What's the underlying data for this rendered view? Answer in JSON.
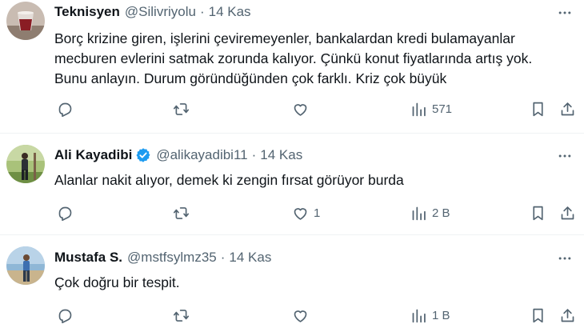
{
  "tweets": [
    {
      "name": "Teknisyen",
      "handle": "@Silivriyolu",
      "dot": "·",
      "time": "14 Kas",
      "text": "Borç krizine giren, işlerini çeviremeyenler, bankalardan kredi bulamayanlar mecburen evlerini satmak zorunda kalıyor.  Çünkü konut fiyatlarında artış yok.  Bunu anlayın.  Durum göründüğünden çok farklı.  Kriz çok büyük",
      "verified": false,
      "replies": "",
      "retweets": "",
      "likes": "",
      "views": "571"
    },
    {
      "name": "Ali Kayadibi",
      "handle": "@alikayadibi11",
      "dot": "·",
      "time": "14 Kas",
      "text": "Alanlar nakit alıyor, demek ki zengin fırsat görüyor burda",
      "verified": true,
      "replies": "",
      "retweets": "",
      "likes": "1",
      "views": "2 B"
    },
    {
      "name": "Mustafa S.",
      "handle": "@mstfsylmz35",
      "dot": "·",
      "time": "14 Kas",
      "text": "Çok doğru bir tespit.",
      "verified": false,
      "replies": "",
      "retweets": "",
      "likes": "",
      "views": "1 B"
    }
  ],
  "colors": {
    "text_primary": "#0f1419",
    "text_secondary": "#536471",
    "verified_blue": "#1d9bf0",
    "divider": "#eff3f4"
  },
  "icons": [
    "more-icon",
    "reply-icon",
    "retweet-icon",
    "like-icon",
    "views-icon",
    "bookmark-icon",
    "share-icon",
    "verified-badge-icon"
  ]
}
